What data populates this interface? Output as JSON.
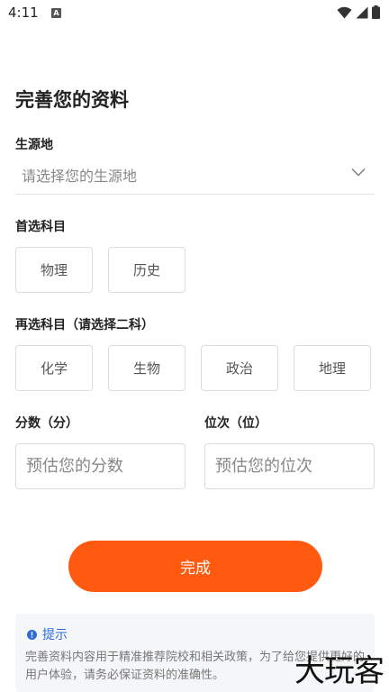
{
  "status_bar": {
    "time": "4:11",
    "notif_badge": "A"
  },
  "page": {
    "title": "完善您的资料"
  },
  "origin": {
    "label": "生源地",
    "placeholder": "请选择您的生源地"
  },
  "first_subject": {
    "label": "首选科目",
    "options": [
      "物理",
      "历史"
    ]
  },
  "second_subject": {
    "label": "再选科目（请选择二科）",
    "options": [
      "化学",
      "生物",
      "政治",
      "地理"
    ]
  },
  "score": {
    "label": "分数（分）",
    "placeholder": "预估您的分数"
  },
  "rank": {
    "label": "位次（位）",
    "placeholder": "预估您的位次"
  },
  "actions": {
    "done_label": "完成"
  },
  "tip": {
    "title": "提示",
    "body": "完善资料内容用于精准推荐院校和相关政策，为了给您提供更好的用户体验，请务必保证资料的准确性。"
  },
  "watermark": {
    "text": "大玩客"
  },
  "colors": {
    "accent": "#ff5a0f",
    "tip_blue": "#2f6bd8"
  }
}
